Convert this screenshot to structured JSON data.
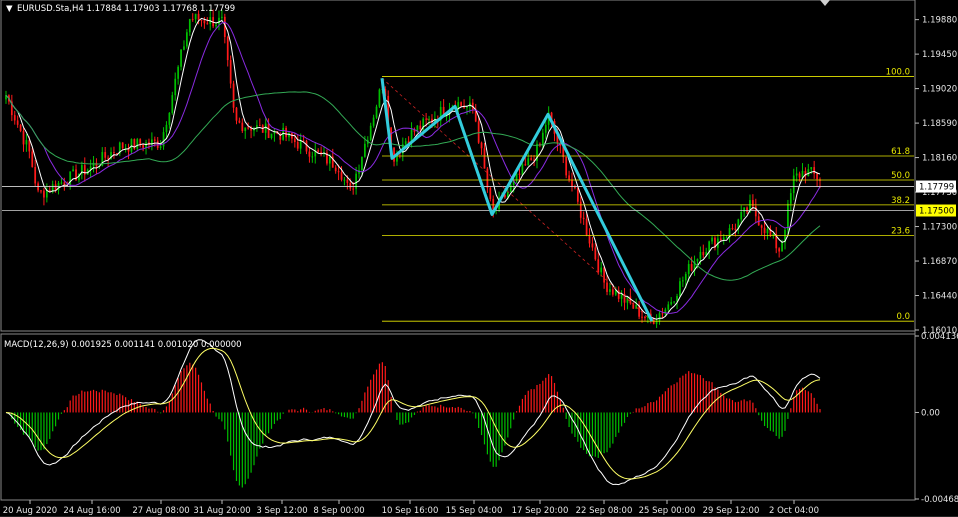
{
  "header": {
    "title": "EURUSD.Sta,H4  1.17884 1.17903 1.17768 1.17799",
    "macd_title": "MACD(12,26,9) 0.001925 0.001141 0.001020 0.000000"
  },
  "price_axis": {
    "ticks": [
      "1.19880",
      "1.19450",
      "1.19020",
      "1.18590",
      "1.18160",
      "1.17730",
      "1.17300",
      "1.16870",
      "1.16440",
      "1.16010"
    ],
    "current_price": "1.17799",
    "marked_price": "1.17500"
  },
  "macd_axis": {
    "ticks": [
      "0.004136",
      "0.00",
      "-0.004681"
    ]
  },
  "time_axis": {
    "labels": [
      "20 Aug 2020",
      "24 Aug 16:00",
      "27 Aug 08:00",
      "31 Aug 20:00",
      "3 Sep 12:00",
      "8 Sep 00:00",
      "10 Sep 16:00",
      "15 Sep 04:00",
      "17 Sep 20:00",
      "22 Sep 08:00",
      "25 Sep 00:00",
      "29 Sep 12:00",
      "2 Oct 04:00"
    ]
  },
  "fibonacci": {
    "levels": [
      "100.0",
      "61.8",
      "50.0",
      "38.2",
      "23.6",
      "0.0"
    ]
  },
  "colors": {
    "background": "#000000",
    "bull": "#00c000",
    "bear": "#ff1a1a",
    "fib": "#e8e800",
    "zigzag": "#33ccdd",
    "ma_fast": "#ffffff",
    "ma_slow": "#8a2be2",
    "ma_long": "#33aa55",
    "macd_signal": "#ffff66",
    "price_label_bg": "#ffffff",
    "marked_label_bg": "#ffff00"
  },
  "chart_data": {
    "type": "line",
    "symbol": "EURUSD.Sta",
    "timeframe": "H4",
    "x": [
      "20 Aug 2020",
      "24 Aug 16:00",
      "27 Aug 08:00",
      "31 Aug 20:00",
      "3 Sep 12:00",
      "8 Sep 00:00",
      "10 Sep 16:00",
      "15 Sep 04:00",
      "17 Sep 20:00",
      "22 Sep 08:00",
      "25 Sep 00:00",
      "29 Sep 12:00",
      "2 Oct 04:00"
    ],
    "series": [
      {
        "values": [
          1.182,
          1.1805,
          1.1835,
          1.1985,
          1.1845,
          1.1805,
          1.1845,
          1.1875,
          1.183,
          1.166,
          1.163,
          1.1725,
          1.179
        ]
      }
    ],
    "ylim": [
      1.1601,
      1.201
    ],
    "zigzag": [
      {
        "t": "10 Sep 00:00",
        "price": 1.1915
      },
      {
        "t": "10 Sep 12:00",
        "price": 1.1815
      },
      {
        "t": "14 Sep 12:00",
        "price": 1.188
      },
      {
        "t": "16 Sep 12:00",
        "price": 1.1745
      },
      {
        "t": "18 Sep 04:00",
        "price": 1.187
      },
      {
        "t": "25 Sep 00:00",
        "price": 1.1612
      }
    ],
    "fibonacci": [
      {
        "level": "100.0",
        "price": 1.1917
      },
      {
        "level": "61.8",
        "price": 1.1818
      },
      {
        "level": "50.0",
        "price": 1.1788
      },
      {
        "level": "38.2",
        "price": 1.1757
      },
      {
        "level": "23.6",
        "price": 1.1719
      },
      {
        "level": "0.0",
        "price": 1.1612
      }
    ],
    "horizontal_lines": [
      1.178,
      1.175
    ],
    "grid": false
  }
}
